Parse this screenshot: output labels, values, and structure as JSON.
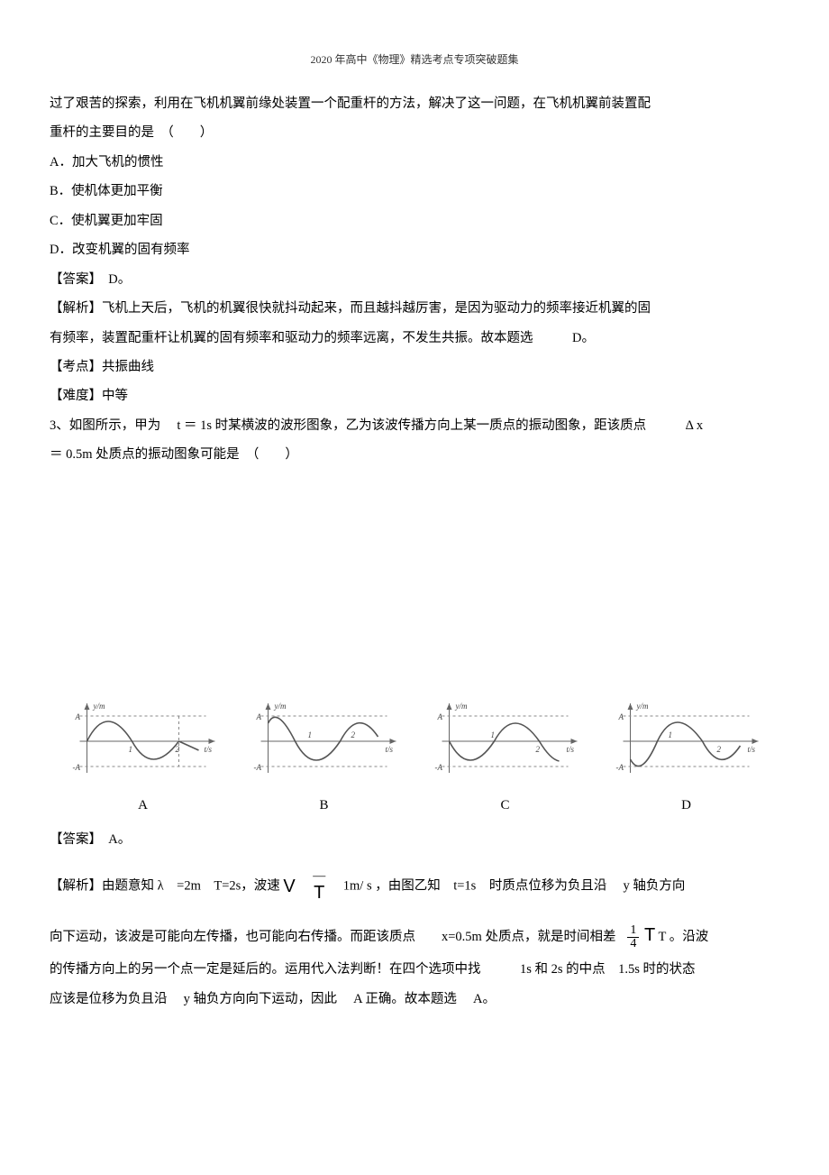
{
  "header": "2020 年高中《物理》精选考点专项突破题集",
  "p1_l1": "过了艰苦的探索，利用在飞机机翼前缘处装置一个配重杆的方法，解决了这一问题，在飞机机翼前装置配",
  "p1_l2": "重杆的主要目的是　（　　）",
  "optA": "A．加大飞机的惯性",
  "optB": "B．使机体更加平衡",
  "optC": "C．使机翼更加牢固",
  "optD": "D．改变机翼的固有频率",
  "ans1": "【答案】　D。",
  "exp1_l1": "【解析】飞机上天后，飞机的机翼很快就抖动起来，而且越抖越厉害，是因为驱动力的频率接近机翼的固",
  "exp1_l2": "有频率，装置配重杆让机翼的固有频率和驱动力的频率远离，不发生共振。故本题选　　　D。",
  "kd1": "【考点】共振曲线",
  "nd1": "【难度】中等",
  "q3_l1": "3、如图所示，甲为　 t ＝ 1s 时某横波的波形图象，乙为该波传播方向上某一质点的振动图象，距该质点　　　Δ x",
  "q3_l2": "＝ 0.5m 处质点的振动图象可能是　（　　）",
  "labA": "A",
  "labB": "B",
  "labC": "C",
  "labD": "D",
  "ans2": "【答案】　A。",
  "exp2_pre": "【解析】由题意知 λ　=2m　T=2s，波速",
  "exp2_v": "V",
  "exp2_dash": "—",
  "exp2_T": "T",
  "exp2_post": "1m/ s ，由图乙知　t=1s　时质点位移为负且沿　 y 轴负方向",
  "exp2_l2a": "向下运动，该波是可能向左传播，也可能向右传播。而距该质点　　x=0.5m 处质点，就是时间相差",
  "frac_n": "1",
  "frac_d": "4",
  "exp2_l2b": "T 。沿波",
  "exp2_l3": "的传播方向上的另一个点一定是延后的。运用代入法判断！在四个选项中找　　　1s 和 2s 的中点　1.5s 时的状态",
  "exp2_l4": "应该是位移为负且沿　 y 轴负方向向下运动，因此　 A 正确。故本题选　 A。"
}
